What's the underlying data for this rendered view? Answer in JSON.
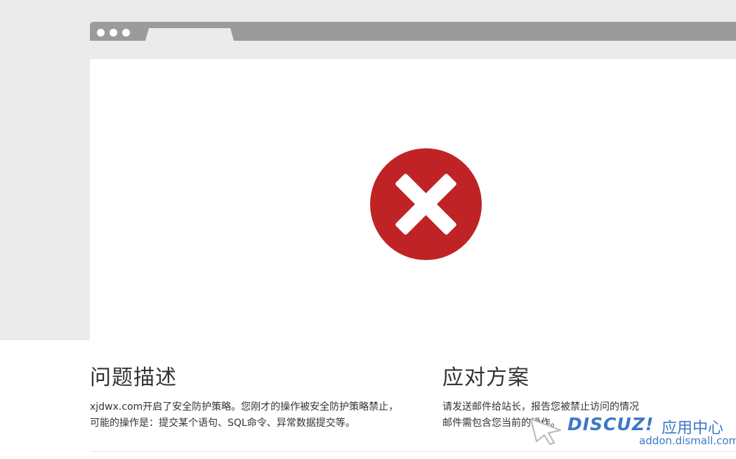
{
  "problem": {
    "title": "问题描述",
    "body": "xjdwx.com开启了安全防护策略。您刚才的操作被安全防护策略禁止，可能的操作是：提交某个语句、SQL命令、异常数据提交等。"
  },
  "solution": {
    "title": "应对方案",
    "line1": "请发送邮件给站长，报告您被禁止访问的情况",
    "line2": "邮件需包含您当前的操作。"
  },
  "watermark": {
    "logo_text": "DISCUZ!",
    "app_center": "应用中心",
    "url": "addon.dismall.com"
  },
  "icons": {
    "error": "error-x-circle-icon"
  },
  "colors": {
    "error_red": "#c02326",
    "chrome_gray": "#9b9b9b",
    "band_gray": "#ebebeb",
    "watermark_blue": "#3c79c7"
  }
}
